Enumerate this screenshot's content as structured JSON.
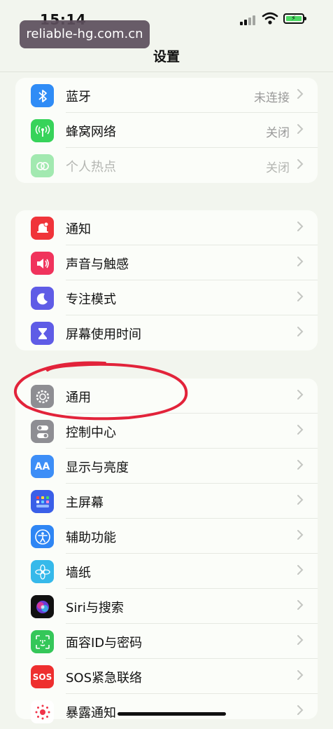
{
  "status_bar": {
    "time": "15:14"
  },
  "watermark": "reliable-hg.com.cn",
  "nav": {
    "title": "设置"
  },
  "groups": [
    {
      "items": [
        {
          "label": "蓝牙",
          "value": "未连接",
          "icon": "bluetooth-icon",
          "color": "#2f8cf6"
        },
        {
          "label": "蜂窝网络",
          "value": "关闭",
          "icon": "cellular-icon",
          "color": "#37d35a"
        },
        {
          "label": "个人热点",
          "value": "关闭",
          "icon": "hotspot-icon",
          "color": "#37d35a"
        }
      ]
    },
    {
      "items": [
        {
          "label": "通知",
          "icon": "notification-bell-icon",
          "color": "#f0343a"
        },
        {
          "label": "声音与触感",
          "icon": "speaker-icon",
          "color": "#f0335c"
        },
        {
          "label": "专注模式",
          "icon": "moon-icon",
          "color": "#5f5ce6"
        },
        {
          "label": "屏幕使用时间",
          "icon": "hourglass-icon",
          "color": "#5f5ce6"
        }
      ]
    },
    {
      "items": [
        {
          "label": "通用",
          "icon": "gear-icon",
          "color": "#8e8e93"
        },
        {
          "label": "控制中心",
          "icon": "toggles-icon",
          "color": "#8e8e93"
        },
        {
          "label": "显示与亮度",
          "icon": "text-size-icon",
          "color": "#3d8ef7"
        },
        {
          "label": "主屏幕",
          "icon": "app-grid-icon",
          "color": "#3a5fe8"
        },
        {
          "label": "辅助功能",
          "icon": "accessibility-icon",
          "color": "#2f86f4"
        },
        {
          "label": "墙纸",
          "icon": "wallpaper-flower-icon",
          "color": "#36b9ea"
        },
        {
          "label": "Siri与搜索",
          "icon": "siri-icon",
          "color": "#111111"
        },
        {
          "label": "面容ID与密码",
          "icon": "face-id-icon",
          "color": "#35c759"
        },
        {
          "label": "SOS紧急联络",
          "icon": "sos-icon",
          "color": "#ee2f2f"
        },
        {
          "label": "暴露通知",
          "icon": "exposure-icon",
          "color": "#ffffff"
        }
      ]
    }
  ],
  "annotation": {
    "circled_item": "通用",
    "color": "#e2233a"
  }
}
